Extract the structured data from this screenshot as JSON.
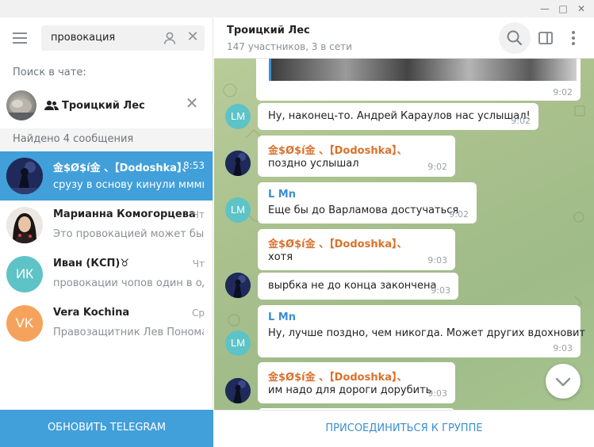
{
  "window": {
    "minimize": "—",
    "maximize": "□",
    "close": "✕"
  },
  "sidebar": {
    "search": {
      "value": "провокация"
    },
    "search_in_label": "Поиск в чате:",
    "search_chat": {
      "name": "Троицкий Лес",
      "icon": "group-icon"
    },
    "found_label": "Найдено 4 сообщения",
    "results": [
      {
        "name": "金$Ø$í金 、【Dodoshka】、",
        "date": "8:53",
        "message": "срузу в основу кинули мммм...",
        "active": true
      },
      {
        "name": "Марианна Комогорцева",
        "date": "Чт",
        "message": "Это провокацией может быть"
      },
      {
        "name": "Иван (КСП)♉",
        "date": "Чт",
        "message": "провокации чопов один в од...",
        "initials": "ИК",
        "color": "#5ec3c7"
      },
      {
        "name": "Vera Kochina",
        "date": "Ср",
        "message": "Правозащитник Лев Пономар...",
        "initials": "VK",
        "color": "#f5a35c"
      }
    ],
    "update_button": "ОБНОВИТЬ TELEGRAM"
  },
  "chat": {
    "title": "Троицкий Лес",
    "subtitle": "147 участников, 3 в сети",
    "first_time": "9:02",
    "messages": [
      {
        "text": "Ну, наконец-то. Андрей Караулов нас услышал!",
        "time": "9:02",
        "avatar": "LM"
      },
      {
        "sender": "金$Ø$í金 、【Dodoshka】、",
        "text": "поздно услышал",
        "time": "9:02"
      },
      {
        "sender": "L Mn",
        "text": "Еще бы до Варламова достучаться",
        "time": "9:02",
        "avatar": "LM"
      },
      {
        "sender": "金$Ø$í金 、【Dodoshka】、",
        "text": "хотя",
        "time": "9:03"
      },
      {
        "text": "вырбка не до конца закончена",
        "time": "9:03"
      },
      {
        "sender": "L Mn",
        "text": "Ну, лучше поздно, чем никогда. Может других вдохновит",
        "time": "9:03",
        "avatar": "LM"
      },
      {
        "sender": "金$Ø$í金 、【Dodoshka】、",
        "text": "им надо для дороги дорубить",
        "time": "9:03"
      }
    ],
    "join_button": "ПРИСОЕДИНИТЬСЯ К ГРУППЕ"
  },
  "colors": {
    "accent": "#419fd9",
    "sender_orange": "#d9722c",
    "sender_blue": "#3a8fd1",
    "lm_avatar": "#5ec3c7",
    "vk_avatar": "#f5a35c"
  }
}
